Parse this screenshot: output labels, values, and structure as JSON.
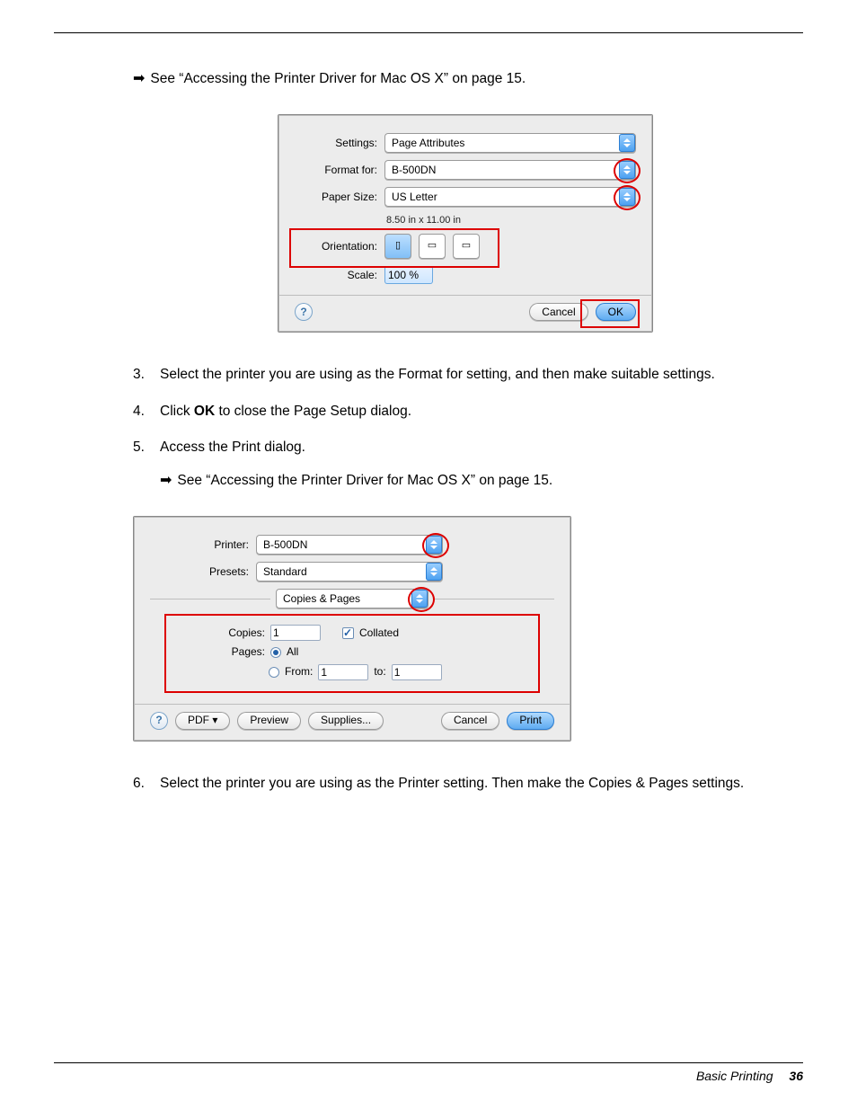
{
  "ref1": "See “Accessing the Printer Driver for Mac OS X” on page 15.",
  "steps": {
    "s3": {
      "num": "3.",
      "text": "Select the printer you are using as the Format for setting, and then make suitable settings."
    },
    "s4": {
      "num": "4.",
      "text_pre": "Click ",
      "bold": "OK",
      "text_post": " to close the Page Setup dialog."
    },
    "s5": {
      "num": "5.",
      "text": "Access the Print dialog."
    },
    "s6": {
      "num": "6.",
      "text": "Select the printer you are using as the Printer setting. Then make the Copies & Pages settings."
    }
  },
  "ref2": "See “Accessing the Printer Driver for Mac OS X” on page 15.",
  "dlg1": {
    "labels": {
      "settings": "Settings:",
      "format_for": "Format for:",
      "paper_size": "Paper Size:",
      "orientation": "Orientation:",
      "scale": "Scale:"
    },
    "values": {
      "settings": "Page Attributes",
      "format_for": "B-500DN",
      "paper_size": "US Letter",
      "paper_dim": "8.50 in x 11.00 in",
      "scale": "100 %"
    },
    "buttons": {
      "help": "?",
      "cancel": "Cancel",
      "ok": "OK"
    }
  },
  "dlg2": {
    "labels": {
      "printer": "Printer:",
      "presets": "Presets:",
      "copies": "Copies:",
      "pages": "Pages:",
      "collated": "Collated",
      "all": "All",
      "from": "From:",
      "to": "to:"
    },
    "values": {
      "printer": "B-500DN",
      "presets": "Standard",
      "section": "Copies & Pages",
      "copies": "1",
      "from": "1",
      "to": "1"
    },
    "buttons": {
      "help": "?",
      "pdf": "PDF ▾",
      "preview": "Preview",
      "supplies": "Supplies...",
      "cancel": "Cancel",
      "print": "Print"
    }
  },
  "footer": {
    "section": "Basic Printing",
    "page": "36"
  }
}
